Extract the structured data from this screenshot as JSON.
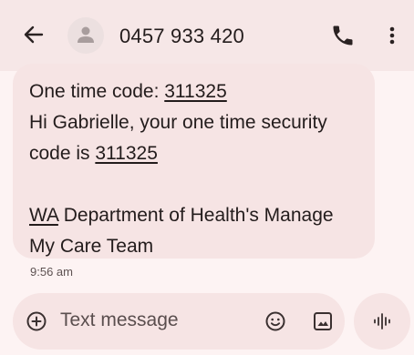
{
  "header": {
    "contact": "0457 933 420",
    "icons": {
      "back": "arrow-back-icon",
      "avatar": "person-icon",
      "call": "phone-icon",
      "menu": "more-vert-icon"
    }
  },
  "message": {
    "line1_prefix": "One time code: ",
    "line1_code": "311325",
    "line2": "Hi Gabrielle, your one time security",
    "line3_prefix": "code is ",
    "line3_code": "311325",
    "line5_link": "WA",
    "line5_rest": " Department of Health's Manage",
    "line6": "My Care Team",
    "timestamp": "9:56 am"
  },
  "compose": {
    "placeholder": "Text message",
    "icons": {
      "add": "add-circle-icon",
      "emoji": "emoji-icon",
      "gallery": "image-icon",
      "voice": "voice-waveform-icon"
    }
  },
  "colors": {
    "background": "#fdf3f3",
    "header": "#f6e7e7",
    "bubble": "#f6e4e4",
    "text": "#231c1c"
  }
}
